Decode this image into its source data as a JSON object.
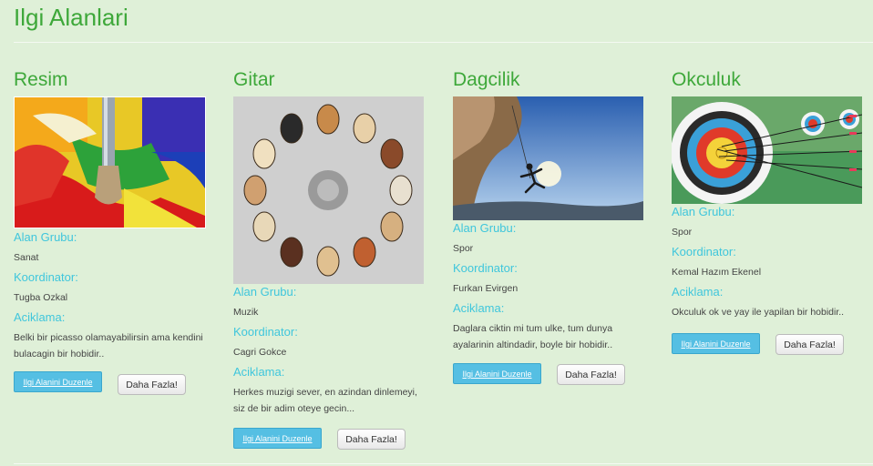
{
  "page": {
    "title": "Ilgi Alanlari"
  },
  "labels": {
    "group": "Alan Grubu:",
    "coordinator": "Koordinator:",
    "description": "Aciklama:"
  },
  "buttons": {
    "edit": "Ilgi Alanini Duzenle",
    "more": "Daha Fazla!"
  },
  "cards": [
    {
      "title": "Resim",
      "group": "Sanat",
      "coordinator": "Tugba Ozkal",
      "description": [
        "Belki bir picasso olamayabilirsin ama kendini",
        "bulacagin bir hobidir.."
      ]
    },
    {
      "title": "Gitar",
      "group": "Muzik",
      "coordinator": "Cagri Gokce",
      "description": [
        "Herkes muzigi sever, en azindan dinlemeyi,",
        "siz de bir adim oteye gecin..."
      ]
    },
    {
      "title": "Dagcilik",
      "group": "Spor",
      "coordinator": "Furkan Evirgen",
      "description": [
        "Daglara ciktin mi tum ulke, tum dunya",
        "ayalarinin altindadir, boyle bir hobidir.."
      ]
    },
    {
      "title": "Okculuk",
      "group": "Spor",
      "coordinator": "Kemal Hazım Ekenel",
      "description": [
        "Okculuk ok ve yay ile yapilan bir hobidir.."
      ]
    }
  ],
  "images": [
    "paintbrush-palette-image",
    "guitars-circle-image",
    "rock-climber-image",
    "archery-target-image"
  ]
}
